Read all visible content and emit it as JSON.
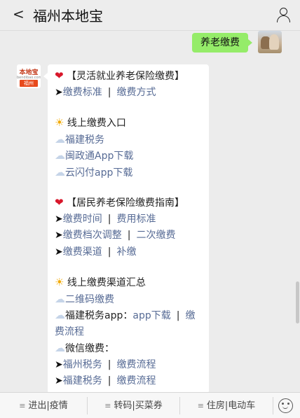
{
  "header": {
    "back_glyph": "<",
    "title": "福州本地宝",
    "profile_icon": "person-icon"
  },
  "user_message": {
    "text": "养老缴费"
  },
  "bot": {
    "avatar": {
      "logo_text": "本地宝",
      "domain_text": "bendibao.com",
      "city": "福州"
    },
    "section1": {
      "icon": "heart-icon",
      "title": "【灵活就业养老保险缴费】",
      "links": [
        "缴费标准",
        "缴费方式"
      ]
    },
    "section2": {
      "icon": "sun-icon",
      "title": "线上缴费入口",
      "items": [
        "福建税务",
        "闽政通App下载",
        "云闪付app下载"
      ]
    },
    "section3": {
      "icon": "heart-icon",
      "title": "【居民养老保险缴费指南】",
      "row1": [
        "缴费时间",
        "费用标准"
      ],
      "row2": [
        "缴费档次调整",
        "二次缴费"
      ],
      "row3": [
        "缴费渠道",
        "补缴"
      ]
    },
    "section4": {
      "icon": "sun-icon",
      "title": "线上缴费渠道汇总",
      "item1": "二维码缴费",
      "item2_label": "福建税务app：",
      "item2_links": [
        "app下载",
        "缴",
        "费流程"
      ],
      "item3_label": "微信缴费：",
      "row_fz": [
        "福州税务",
        "缴费流程"
      ],
      "row_fj": [
        "福建税务",
        "缴费流程"
      ]
    }
  },
  "bottom_menu": {
    "tabs": [
      "进出|疫情",
      "转码|买菜券",
      "住房|电动车"
    ],
    "menu_icon": "≡",
    "emoji_icon": "smile-icon"
  },
  "colors": {
    "link": "#576b95",
    "bubble": "#95ec69",
    "heart": "#d8172b",
    "sun": "#f2a900"
  }
}
